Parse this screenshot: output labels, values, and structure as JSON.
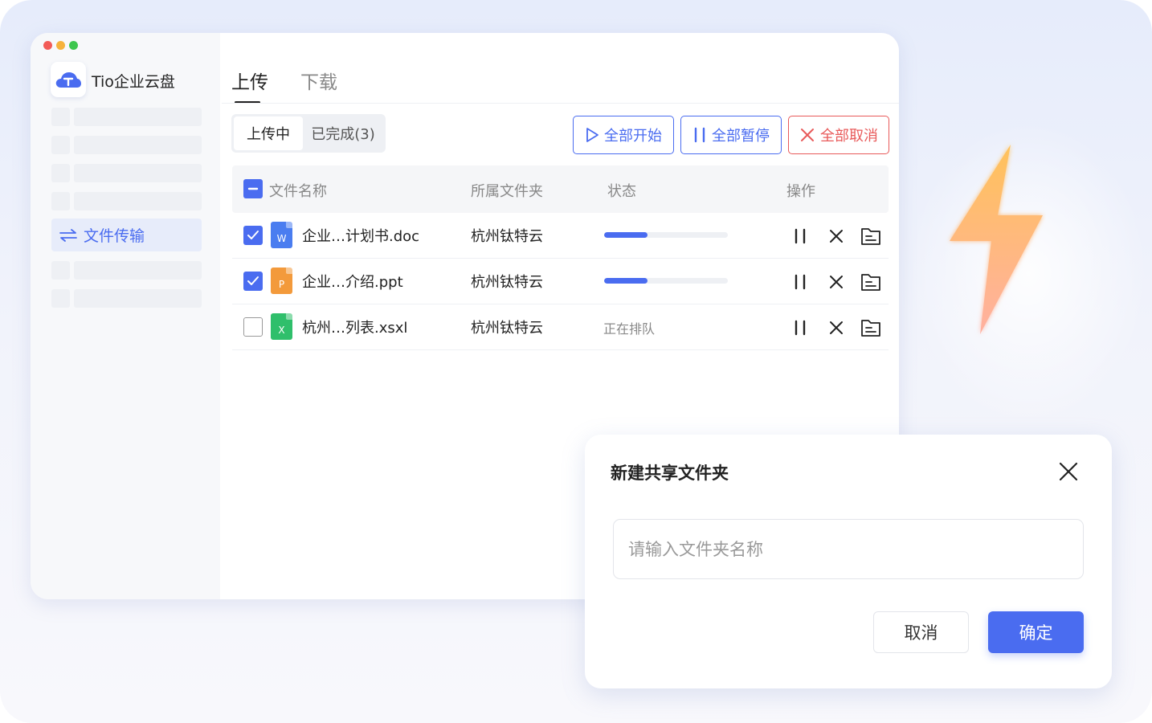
{
  "app": {
    "name": "Tio企业云盘",
    "traffic_lights": [
      "#f25b57",
      "#f6b23c",
      "#3ec64e"
    ],
    "accent": "#4a6cf0",
    "danger": "#e85a5a"
  },
  "sidebar": {
    "active_item": {
      "label": "文件传输",
      "icon": "transfer-icon"
    }
  },
  "tabs": [
    {
      "label": "上传",
      "active": true
    },
    {
      "label": "下载",
      "active": false
    }
  ],
  "segment": [
    {
      "label": "上传中",
      "active": true
    },
    {
      "label": "已完成(3)",
      "active": false
    }
  ],
  "actions": {
    "start_all": "全部开始",
    "pause_all": "全部暂停",
    "cancel_all": "全部取消"
  },
  "table": {
    "headers": {
      "name": "文件名称",
      "folder": "所属文件夹",
      "status": "状态",
      "ops": "操作"
    },
    "rows": [
      {
        "checked": true,
        "type": "word",
        "type_letter": "W",
        "type_color": "#4a7df0",
        "name": "企业…计划书.doc",
        "folder": "杭州钛特云",
        "progress": 0.35,
        "status": ""
      },
      {
        "checked": true,
        "type": "ppt",
        "type_letter": "P",
        "type_color": "#f39a3b",
        "name": "企业…介绍.ppt",
        "folder": "杭州钛特云",
        "progress": 0.35,
        "status": ""
      },
      {
        "checked": false,
        "type": "excel",
        "type_letter": "X",
        "type_color": "#2fbf6b",
        "name": "杭州…列表.xsxl",
        "folder": "杭州钛特云",
        "progress": null,
        "status": "正在排队"
      }
    ]
  },
  "dialog": {
    "title": "新建共享文件夹",
    "input_placeholder": "请输入文件夹名称",
    "input_value": "",
    "cancel": "取消",
    "confirm": "确定"
  }
}
